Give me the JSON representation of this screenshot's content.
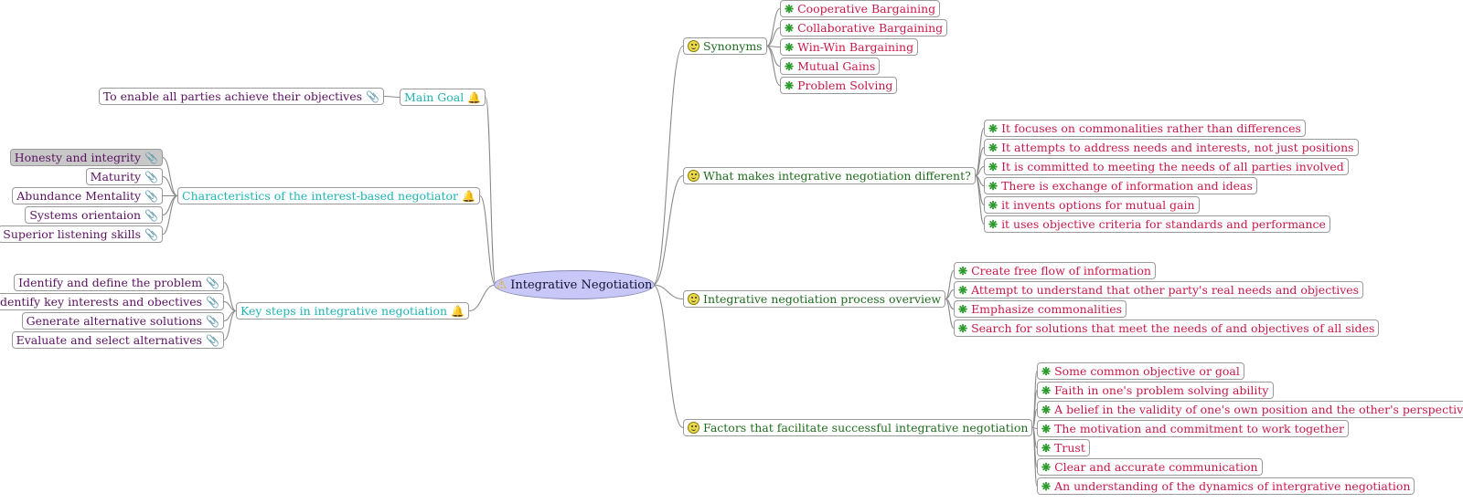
{
  "mindmap": {
    "root": {
      "label": "Integrative Negotiation",
      "icon": "warning-icon",
      "fill": "#c8c8f8"
    },
    "left_branches": [
      {
        "label": "Main Goal",
        "icon": "bell-icon",
        "children": [
          {
            "label": "To enable all parties achieve their objectives",
            "icon": "paperclip-icon"
          }
        ]
      },
      {
        "label": "Characteristics of the interest-based negotiator",
        "icon": "bell-icon",
        "children": [
          {
            "label": "Honesty and integrity",
            "icon": "paperclip-icon",
            "selected": true
          },
          {
            "label": "Maturity",
            "icon": "paperclip-icon"
          },
          {
            "label": "Abundance Mentality",
            "icon": "paperclip-icon"
          },
          {
            "label": "Systems orientaion",
            "icon": "paperclip-icon"
          },
          {
            "label": "Superior listening skills",
            "icon": "paperclip-icon"
          }
        ]
      },
      {
        "label": "Key steps in integrative negotiation",
        "icon": "bell-icon",
        "children": [
          {
            "label": "Identify and define the problem",
            "icon": "paperclip-icon"
          },
          {
            "label": "Identify key interests and obectives",
            "icon": "paperclip-icon"
          },
          {
            "label": "Generate alternative solutions",
            "icon": "paperclip-icon"
          },
          {
            "label": "Evaluate and select alternatives",
            "icon": "paperclip-icon"
          }
        ]
      }
    ],
    "right_branches": [
      {
        "label": "Synonyms",
        "icon": "smiley-icon",
        "children": [
          {
            "label": "Cooperative Bargaining",
            "icon": "flower-icon"
          },
          {
            "label": "Collaborative Bargaining",
            "icon": "flower-icon"
          },
          {
            "label": "Win-Win Bargaining",
            "icon": "flower-icon"
          },
          {
            "label": "Mutual Gains",
            "icon": "flower-icon"
          },
          {
            "label": "Problem Solving",
            "icon": "flower-icon"
          }
        ]
      },
      {
        "label": "What makes integrative negotiation different?",
        "icon": "smiley-icon",
        "children": [
          {
            "label": "It focuses on commonalities rather than differences",
            "icon": "flower-icon"
          },
          {
            "label": "It attempts to address needs and interests, not just positions",
            "icon": "flower-icon"
          },
          {
            "label": "It is committed to meeting the needs of all parties involved",
            "icon": "flower-icon"
          },
          {
            "label": "There is exchange of information and ideas",
            "icon": "flower-icon"
          },
          {
            "label": "it invents options for mutual gain",
            "icon": "flower-icon"
          },
          {
            "label": "it uses objective criteria for standards and performance",
            "icon": "flower-icon"
          }
        ]
      },
      {
        "label": "Integrative negotiation process overview",
        "icon": "smiley-icon",
        "children": [
          {
            "label": "Create free flow of information",
            "icon": "flower-icon"
          },
          {
            "label": "Attempt to understand that other party's real needs and objectives",
            "icon": "flower-icon"
          },
          {
            "label": "Emphasize commonalities",
            "icon": "flower-icon"
          },
          {
            "label": "Search for solutions that meet the needs of and objectives of all sides",
            "icon": "flower-icon"
          }
        ]
      },
      {
        "label": "Factors that facilitate successful integrative negotiation",
        "icon": "smiley-icon",
        "children": [
          {
            "label": "Some common objective or goal",
            "icon": "flower-icon"
          },
          {
            "label": "Faith in one's problem solving ability",
            "icon": "flower-icon"
          },
          {
            "label": "A belief in the validity of one's own position and the other's perspective",
            "icon": "flower-icon"
          },
          {
            "label": "The motivation and commitment to work together",
            "icon": "flower-icon"
          },
          {
            "label": "Trust",
            "icon": "flower-icon"
          },
          {
            "label": "Clear and accurate communication",
            "icon": "flower-icon"
          },
          {
            "label": "An understanding of the dynamics of intergrative negotiation",
            "icon": "flower-icon"
          }
        ]
      }
    ]
  }
}
